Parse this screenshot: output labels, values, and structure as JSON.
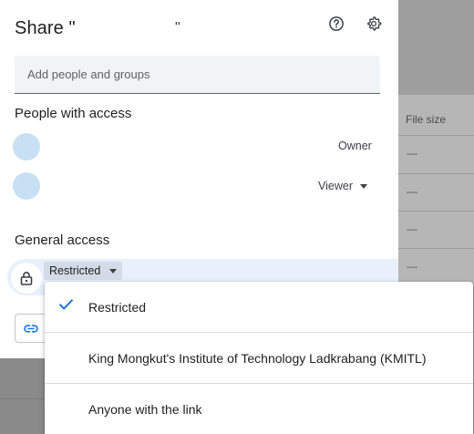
{
  "dialog": {
    "title": "Share \"",
    "title_end_quote": "\"",
    "add_people_placeholder": "Add people and groups",
    "people_heading": "People with access",
    "people": [
      {
        "role": "Owner"
      },
      {
        "role": "Viewer"
      }
    ],
    "general_access_heading": "General access",
    "access_value": "Restricted"
  },
  "access_menu": {
    "options": [
      {
        "label": "Restricted",
        "selected": true
      },
      {
        "label": "King Mongkut's Institute of Technology Ladkrabang (KMITL)",
        "selected": false
      },
      {
        "label": "Anyone with the link",
        "selected": false
      }
    ]
  },
  "background": {
    "column_header": "File size",
    "cell_placeholder": "—"
  },
  "colors": {
    "accent": "#1a73e8",
    "access_highlight": "#e8f0fe",
    "avatar": "#c8e0f4"
  }
}
